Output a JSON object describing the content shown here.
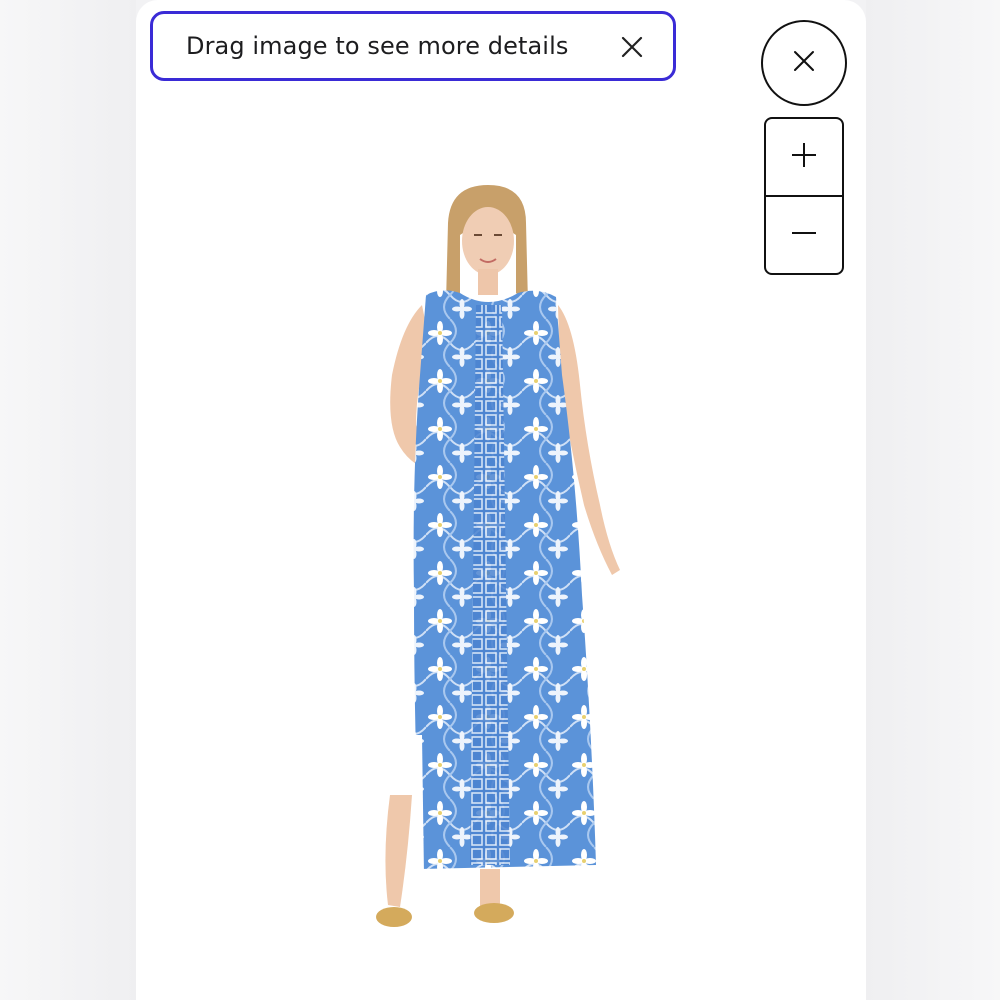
{
  "hint": {
    "text": "Drag image to see more details",
    "close_icon": "close-icon"
  },
  "controls": {
    "close_icon": "close-icon",
    "zoom_in_icon": "plus-icon",
    "zoom_out_icon": "minus-icon"
  },
  "product": {
    "image": "model-wearing-blue-floral-print-maxi-dress"
  },
  "colors": {
    "accent_border": "#3a2bd6",
    "dress_blue": "#5b93d9",
    "text": "#1d1d1f"
  }
}
